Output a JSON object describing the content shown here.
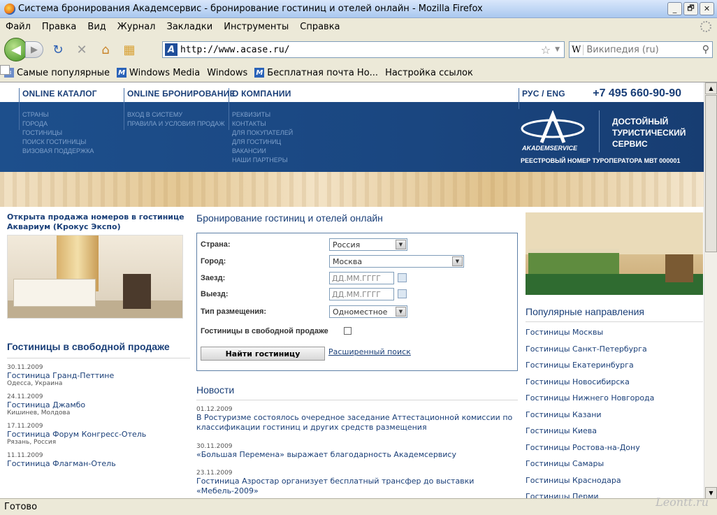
{
  "window": {
    "title": "Система бронирования Академсервис - бронирование гостиниц и отелей онлайн - Mozilla Firefox",
    "min": "_",
    "max": "🗗",
    "close": "✕"
  },
  "menu": [
    "Файл",
    "Правка",
    "Вид",
    "Журнал",
    "Закладки",
    "Инструменты",
    "Справка"
  ],
  "toolbar": {
    "url": "http://www.acase.ru/",
    "search_placeholder": "Википедия (ru)",
    "wiki": "W",
    "site_icon": "A"
  },
  "icons": {
    "back": "back-arrow-icon",
    "forward": "forward-arrow-icon",
    "reload": "reload-icon",
    "stop": "stop-icon",
    "home": "home-icon",
    "star": "bookmark-star-icon",
    "search": "magnifier-icon"
  },
  "bookmarks": [
    "Самые популярные",
    "Windows Media",
    "Windows",
    "Бесплатная почта Но...",
    "Настройка ссылок"
  ],
  "site": {
    "nav": [
      "ONLINE КАТАЛОГ",
      "ONLINE БРОНИРОВАНИЕ",
      "О КОМПАНИИ"
    ],
    "lang": "РУС / ENG",
    "phone": "+7 495 660-90-90",
    "catalog_links": [
      "СТРАНЫ",
      "ГОРОДА",
      "ГОСТИНИЦЫ",
      "ПОИСК ГОСТИНИЦЫ",
      "ВИЗОВАЯ ПОДДЕРЖКА"
    ],
    "booking_links": [
      "ВХОД В СИСТЕМУ",
      "ПРАВИЛА И УСЛОВИЯ ПРОДАЖ"
    ],
    "company_links": [
      "РЕКВИЗИТЫ",
      "КОНТАКТЫ",
      "ДЛЯ ПОКУПАТЕЛЕЙ",
      "ДЛЯ ГОСТИНИЦ",
      "ВАКАНСИИ",
      "НАШИ ПАРТНЕРЫ"
    ],
    "logo_text": "AKADEMSERVICE",
    "slogan": [
      "ДОСТОЙНЫЙ",
      "ТУРИСТИЧЕСКИЙ",
      "СЕРВИС"
    ],
    "registry": "РЕЕСТРОВЫЙ НОМЕР ТУРОПЕРАТОРА МВТ 000001"
  },
  "left": {
    "promo": "Открыта продажа номеров в гостинице Аквариум (Крокус Экспо)",
    "section_title": "Гостиницы в свободной продаже",
    "hotels": [
      {
        "date": "30.11.2009",
        "name": "Гостиница Гранд-Петтине",
        "city": "Одесса, Украина"
      },
      {
        "date": "24.11.2009",
        "name": "Гостиница Джамбо",
        "city": "Кишинев, Молдова"
      },
      {
        "date": "17.11.2009",
        "name": "Гостиница Форум Конгресс-Отель",
        "city": "Рязань, Россия"
      },
      {
        "date": "11.11.2009",
        "name": "Гостиница Флагман-Отель",
        "city": ""
      }
    ]
  },
  "booking": {
    "title": "Бронирование гостиниц и отелей онлайн",
    "country_label": "Страна:",
    "country_value": "Россия",
    "city_label": "Город:",
    "city_value": "Москва",
    "checkin_label": "Заезд:",
    "checkin_placeholder": "ДД.ММ.ГГГГ",
    "checkout_label": "Выезд:",
    "checkout_placeholder": "ДД.ММ.ГГГГ",
    "accommodation_label": "Тип размещения:",
    "accommodation_value": "Одноместное",
    "free_sale_label": "Гостиницы в свободной продаже",
    "find_button": "Найти гостиницу",
    "advanced_link": "Расширенный поиск"
  },
  "news": {
    "title": "Новости",
    "items": [
      {
        "date": "01.12.2009",
        "text": "В Ростуризме состоялось очередное заседание Аттестационной комиссии по классификации гостиниц и других средств размещения"
      },
      {
        "date": "30.11.2009",
        "text": "«Большая Перемена» выражает благодарность Академсервису"
      },
      {
        "date": "23.11.2009",
        "text": "Гостиница Азростар организует бесплатный трансфер до выставки «Мебель-2009»"
      }
    ]
  },
  "right": {
    "title": "Популярные направления",
    "destinations": [
      "Гостиницы Москвы",
      "Гостиницы Санкт-Петербурга",
      "Гостиницы Екатеринбурга",
      "Гостиницы Новосибирска",
      "Гостиницы Нижнего Новгорода",
      "Гостиницы Казани",
      "Гостиницы Киева",
      "Гостиницы Ростова-на-Дону",
      "Гостиницы Самары",
      "Гостиницы Краснодара",
      "Гостиницы Перми"
    ]
  },
  "status": "Готово",
  "watermark": "Leontt.ru"
}
